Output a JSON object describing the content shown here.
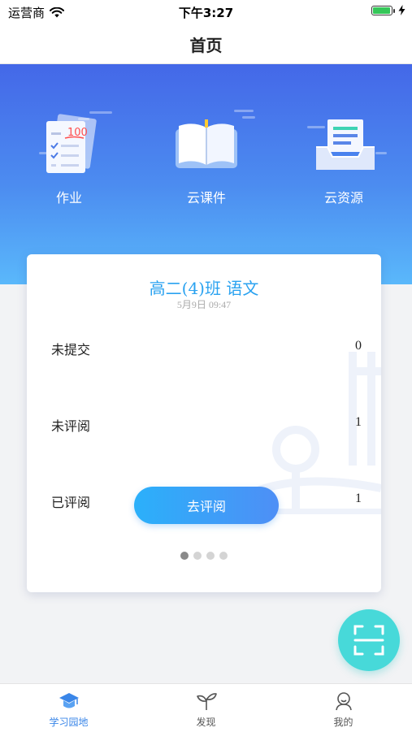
{
  "status_bar": {
    "carrier": "运营商",
    "time": "下午3:27"
  },
  "nav": {
    "title": "首页"
  },
  "shortcuts": [
    {
      "label": "作业",
      "icon": "homework-icon"
    },
    {
      "label": "云课件",
      "icon": "open-book-icon"
    },
    {
      "label": "云资源",
      "icon": "inbox-tray-icon"
    }
  ],
  "card": {
    "title": "高二(4)班 语文",
    "date": "5月9日 09:47",
    "rows": [
      {
        "label": "未提交",
        "value": "0"
      },
      {
        "label": "未评阅",
        "value": "1"
      },
      {
        "label": "已评阅",
        "value": "1"
      }
    ],
    "action_label": "去评阅",
    "page_count": 4,
    "active_page": 1
  },
  "homework_icon_text": "100",
  "colors": {
    "accent": "#2aa2f0",
    "hero_top": "#4468e8",
    "hero_bottom": "#5ab8fb",
    "fab": "#47d9d9",
    "tab_active": "#3a86e8"
  },
  "tabs": [
    {
      "label": "学习园地",
      "icon": "graduation-cap-icon",
      "active": true
    },
    {
      "label": "发现",
      "icon": "sprout-icon",
      "active": false
    },
    {
      "label": "我的",
      "icon": "user-icon",
      "active": false
    }
  ]
}
